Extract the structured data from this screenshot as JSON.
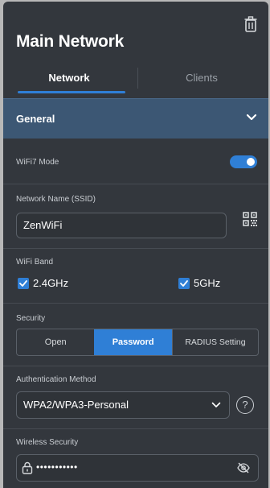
{
  "header": {
    "title": "Main Network"
  },
  "tabs": [
    {
      "label": "Network",
      "active": true
    },
    {
      "label": "Clients",
      "active": false
    }
  ],
  "section": {
    "label": "General"
  },
  "wifi7": {
    "label": "WiFi7 Mode",
    "enabled": true
  },
  "ssid": {
    "label": "Network Name (SSID)",
    "value": "ZenWiFi"
  },
  "band": {
    "label": "WiFi Band",
    "options": [
      {
        "label": "2.4GHz",
        "checked": true
      },
      {
        "label": "5GHz",
        "checked": true
      }
    ]
  },
  "security": {
    "label": "Security",
    "options": [
      "Open",
      "Password",
      "RADIUS Setting"
    ],
    "selected": "Password"
  },
  "auth": {
    "label": "Authentication Method",
    "value": "WPA2/WPA3-Personal",
    "help": "?"
  },
  "wireless_security": {
    "label": "Wireless Security",
    "value": "•••••••••••"
  },
  "colors": {
    "accent": "#2f7fd6",
    "panel": "#33373d",
    "section": "#3c5774"
  }
}
